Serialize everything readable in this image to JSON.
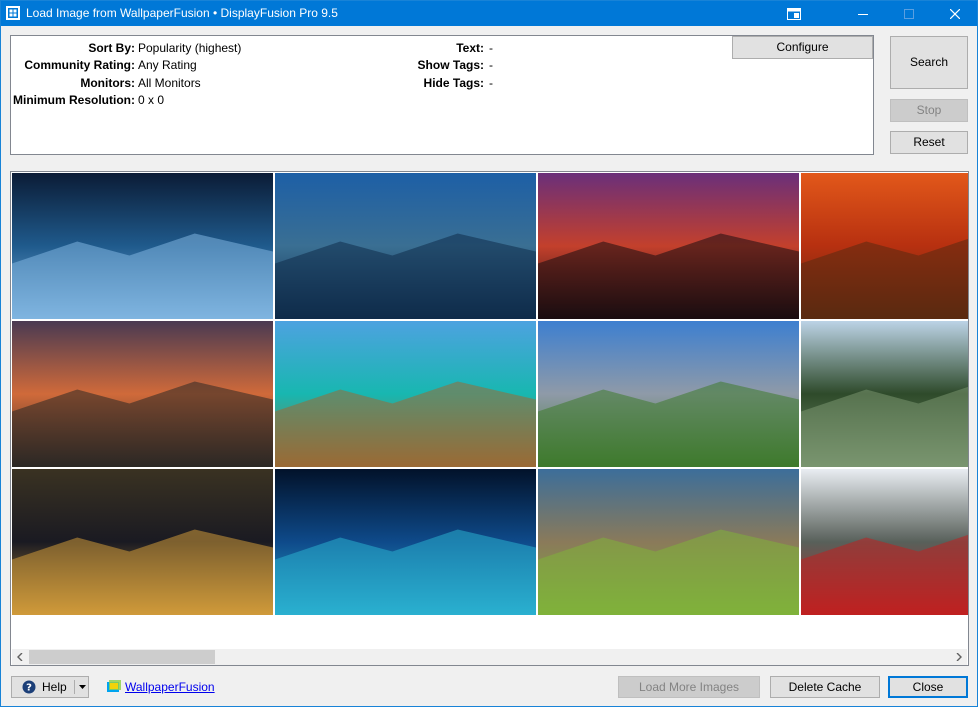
{
  "window": {
    "title": "Load Image from WallpaperFusion • DisplayFusion Pro 9.5",
    "accent": "#0078d7"
  },
  "filters": {
    "sort_by_label": "Sort By:",
    "sort_by_value": "Popularity (highest)",
    "rating_label": "Community Rating:",
    "rating_value": "Any Rating",
    "monitors_label": "Monitors:",
    "monitors_value": "All Monitors",
    "resolution_label": "Minimum Resolution:",
    "resolution_value": "0 x 0",
    "text_label": "Text:",
    "text_value": "-",
    "show_tags_label": "Show Tags:",
    "show_tags_value": "-",
    "hide_tags_label": "Hide Tags:",
    "hide_tags_value": "-"
  },
  "buttons": {
    "configure": "Configure",
    "search": "Search",
    "stop": "Stop",
    "reset": "Reset",
    "help": "Help",
    "load_more": "Load More Images",
    "delete_cache": "Delete Cache",
    "close": "Close"
  },
  "footer": {
    "link": "WallpaperFusion"
  },
  "thumbnails": [
    {
      "subject": "moonlit icy mountains",
      "colors": [
        "#0b1c36",
        "#1f5a8c",
        "#7fb5e0"
      ]
    },
    {
      "subject": "alpine lake reflection",
      "colors": [
        "#1d5fa6",
        "#3a6f93",
        "#0f2b4a"
      ]
    },
    {
      "subject": "tree silhouette at sunset",
      "colors": [
        "#6a2f7a",
        "#c3402c",
        "#1a0c10"
      ]
    },
    {
      "subject": "autumn red forest",
      "colors": [
        "#e2581a",
        "#b73010",
        "#5a2a10"
      ]
    },
    {
      "subject": "rocky coast sunset",
      "colors": [
        "#4a3a52",
        "#d06a3a",
        "#2b2825"
      ]
    },
    {
      "subject": "overwater bungalows",
      "colors": [
        "#4da2e0",
        "#18b7b0",
        "#9b6a34"
      ]
    },
    {
      "subject": "alpine village",
      "colors": [
        "#3d7fd0",
        "#8f9aa8",
        "#3e7a2c"
      ]
    },
    {
      "subject": "mountain valley lake",
      "colors": [
        "#bcd3e6",
        "#2e4a2a",
        "#7a9670"
      ]
    },
    {
      "subject": "city skyline at night",
      "colors": [
        "#3a3222",
        "#1a1a22",
        "#d09a3a"
      ]
    },
    {
      "subject": "blue nebula",
      "colors": [
        "#02122a",
        "#0e4a8a",
        "#2ab0d0"
      ]
    },
    {
      "subject": "sand dunes with moss",
      "colors": [
        "#3c6e9a",
        "#8a7a5a",
        "#7fb23a"
      ]
    },
    {
      "subject": "snowy train viaduct",
      "colors": [
        "#e9edf2",
        "#58605a",
        "#c02020"
      ]
    }
  ]
}
